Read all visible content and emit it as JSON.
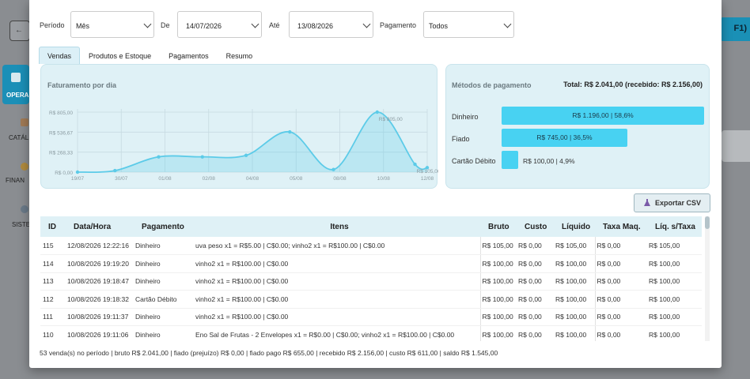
{
  "background": {
    "left_button_glyph": "←",
    "right_button_label": "F1)",
    "sidebar": [
      {
        "label": "OPERA",
        "active": true
      },
      {
        "label": "CATÁL",
        "active": false
      },
      {
        "label": "FINAN",
        "active": false
      },
      {
        "label": "SISTE",
        "active": false
      }
    ]
  },
  "filters": {
    "periodo_label": "Período",
    "periodo_value": "Mês",
    "de_label": "De",
    "de_value": "14/07/2026",
    "ate_label": "Até",
    "ate_value": "13/08/2026",
    "pagamento_label": "Pagamento",
    "pagamento_value": "Todos"
  },
  "tabs": [
    {
      "label": "Vendas",
      "active": true
    },
    {
      "label": "Produtos e Estoque",
      "active": false
    },
    {
      "label": "Pagamentos",
      "active": false
    },
    {
      "label": "Resumo",
      "active": false
    }
  ],
  "faturamento": {
    "title": "Faturamento por dia"
  },
  "chart_data": {
    "type": "area",
    "title": "Faturamento por dia",
    "x": [
      "19/07",
      "30/07",
      "01/08",
      "02/08",
      "04/08",
      "05/08",
      "08/08",
      "10/08",
      "12/08"
    ],
    "y_ticks": [
      "R$ 0,00",
      "R$ 268,33",
      "R$ 536,67",
      "R$ 805,00"
    ],
    "ylim": [
      0,
      805
    ],
    "points": [
      {
        "x": 0.0,
        "y": 0
      },
      {
        "x": 0.107,
        "y": 20
      },
      {
        "x": 0.232,
        "y": 205
      },
      {
        "x": 0.357,
        "y": 205
      },
      {
        "x": 0.482,
        "y": 225
      },
      {
        "x": 0.607,
        "y": 540
      },
      {
        "x": 0.732,
        "y": 35
      },
      {
        "x": 0.857,
        "y": 805
      },
      {
        "x": 0.965,
        "y": 105
      },
      {
        "x": 1.0,
        "y": 60
      }
    ],
    "point_labels": [
      {
        "index": 7,
        "text": "R$ 805,00"
      },
      {
        "index": 8,
        "text": "R$ 105,00"
      }
    ],
    "color": "#5ccbe8",
    "grid": true
  },
  "metodos": {
    "title": "Métodos de pagamento",
    "total_text": "Total: R$ 2.041,00  (recebido: R$ 2.156,00)",
    "rows": [
      {
        "label": "Dinheiro",
        "text": "R$ 1.196,00  |  58,6%",
        "share": 0.586,
        "inside": true
      },
      {
        "label": "Fiado",
        "text": "R$ 745,00  |  36,5%",
        "share": 0.365,
        "inside": true
      },
      {
        "label": "Cartão Débito",
        "text": "R$ 100,00  |  4,9%",
        "share": 0.049,
        "inside": false
      }
    ]
  },
  "export_label": "Exportar CSV",
  "table": {
    "headers": [
      "ID",
      "Data/Hora",
      "Pagamento",
      "Itens",
      "Bruto",
      "Custo",
      "Líquido",
      "Taxa Maq.",
      "Líq. s/Taxa"
    ],
    "rows": [
      [
        "115",
        "12/08/2026 12:22:16",
        "Dinheiro",
        "uva peso x1 = R$5.00 | C$0.00; vinho2 x1 = R$100.00 | C$0.00",
        "R$ 105,00",
        "R$ 0,00",
        "R$ 105,00",
        "R$ 0,00",
        "R$ 105,00"
      ],
      [
        "114",
        "10/08/2026 19:19:20",
        "Dinheiro",
        "vinho2 x1 = R$100.00 | C$0.00",
        "R$ 100,00",
        "R$ 0,00",
        "R$ 100,00",
        "R$ 0,00",
        "R$ 100,00"
      ],
      [
        "113",
        "10/08/2026 19:18:47",
        "Dinheiro",
        "vinho2 x1 = R$100.00 | C$0.00",
        "R$ 100,00",
        "R$ 0,00",
        "R$ 100,00",
        "R$ 0,00",
        "R$ 100,00"
      ],
      [
        "112",
        "10/08/2026 19:18:32",
        "Cartão Débito",
        "vinho2 x1 = R$100.00 | C$0.00",
        "R$ 100,00",
        "R$ 0,00",
        "R$ 100,00",
        "R$ 0,00",
        "R$ 100,00"
      ],
      [
        "111",
        "10/08/2026 19:11:37",
        "Dinheiro",
        "vinho2 x1 = R$100.00 | C$0.00",
        "R$ 100,00",
        "R$ 0,00",
        "R$ 100,00",
        "R$ 0,00",
        "R$ 100,00"
      ],
      [
        "110",
        "10/08/2026 19:11:06",
        "Dinheiro",
        "Eno Sal de Frutas - 2 Envelopes x1 = R$0.00 | C$0.00; vinho2 x1 = R$100.00 | C$0.00",
        "R$ 100,00",
        "R$ 0,00",
        "R$ 100,00",
        "R$ 0,00",
        "R$ 100,00"
      ]
    ]
  },
  "footer": "53 venda(s) no período  |  bruto R$ 2.041,00  |  fiado (prejuízo) R$ 0,00  |  fiado pago R$ 655,00  |  recebido R$ 2.156,00  |  custo R$ 611,00  |  saldo R$ 1.545,00"
}
